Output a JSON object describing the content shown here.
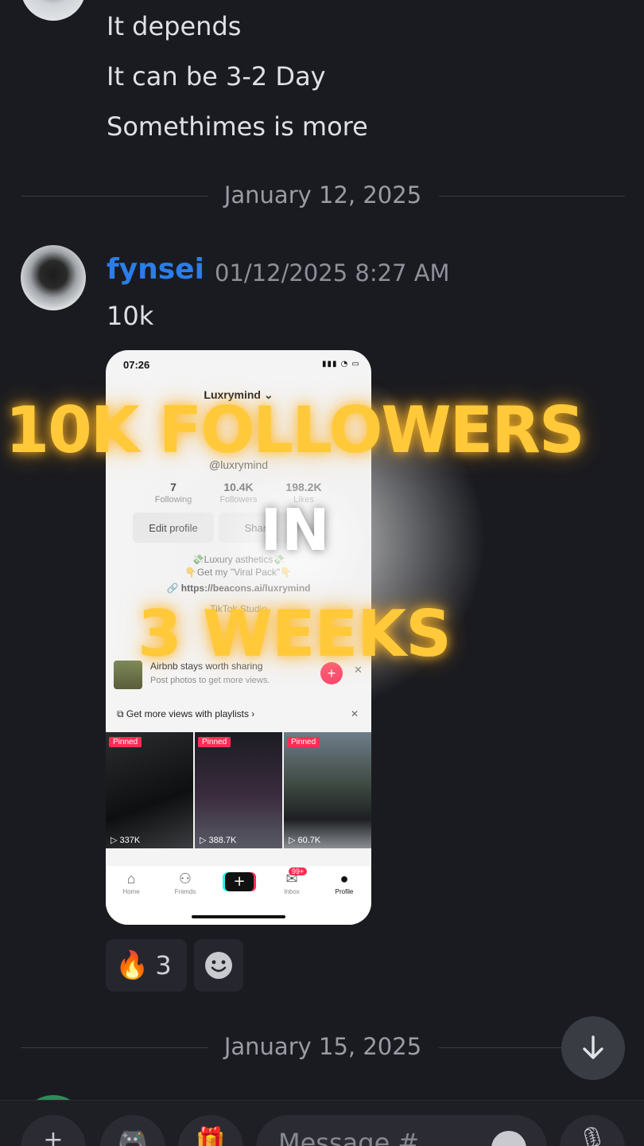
{
  "previous_message": {
    "lines": [
      "It depends",
      "It can be 3-2 Day",
      "Somethimes is more"
    ]
  },
  "date_dividers": [
    "January 12, 2025",
    "January 15, 2025"
  ],
  "message": {
    "username": "fynsei",
    "timestamp": "01/12/2025 8:27 AM",
    "text": "10k"
  },
  "attachment": {
    "status_time": "07:26",
    "status_icons": "▮▮▮ ◔ ▭",
    "account_name": "Luxrymind ⌄",
    "handle": "@luxrymind",
    "stats": [
      {
        "value": "7",
        "label": "Following"
      },
      {
        "value": "10.4K",
        "label": "Followers"
      },
      {
        "value": "198.2K",
        "label": "Likes"
      }
    ],
    "buttons": [
      "Edit profile",
      "Share"
    ],
    "bio": [
      "💸Luxury asthetics💸",
      "👇Get my \"Viral Pack\"👇",
      "🔗 https://beacons.ai/luxrymind",
      "TikTok Studio"
    ],
    "card": {
      "title": "Airbnb stays worth sharing",
      "subtitle": "Post photos to get more views.",
      "close": "✕",
      "plus": "+"
    },
    "playlist": "⧉ Get more views with playlists ›",
    "playlist_close": "✕",
    "tiles": [
      {
        "pinned": "Pinned",
        "views": "▷ 337K"
      },
      {
        "pinned": "Pinned",
        "views": "▷ 388.7K"
      },
      {
        "pinned": "Pinned",
        "views": "▷ 60.7K"
      }
    ],
    "nav": [
      {
        "icon": "⌂",
        "label": "Home"
      },
      {
        "icon": "⚇",
        "label": "Friends"
      },
      {
        "icon": "✉",
        "label": "Inbox"
      },
      {
        "icon": "●",
        "label": "Profile"
      }
    ],
    "nav_add": "+",
    "inbox_badge": "99+"
  },
  "overlay_text": {
    "line1": "10K FOLLOWERS",
    "line2": "IN",
    "line3": "3 WEEKS"
  },
  "reactions": [
    {
      "emoji": "🔥",
      "count": "3"
    }
  ],
  "composer": {
    "placeholder": "Message #"
  }
}
